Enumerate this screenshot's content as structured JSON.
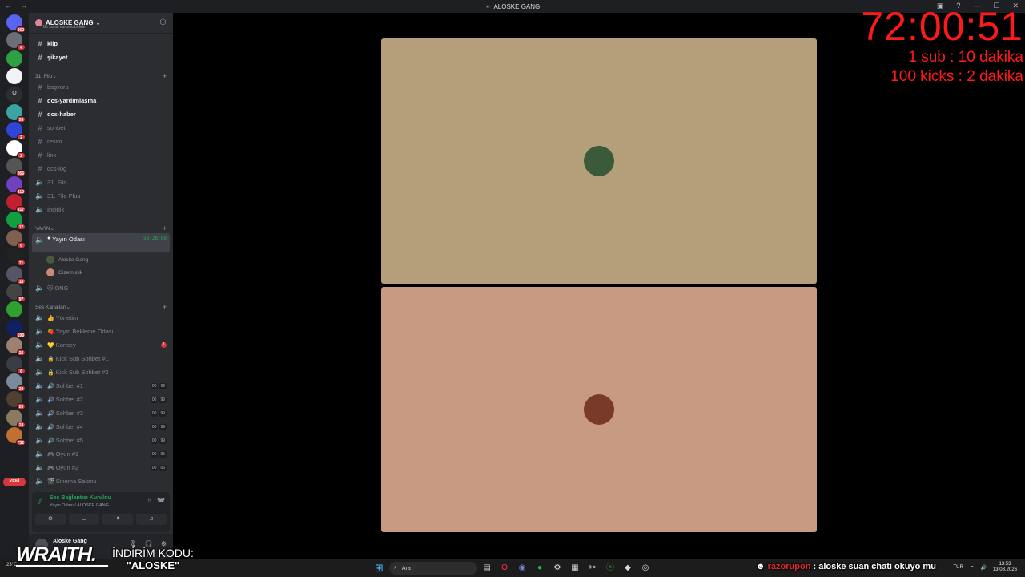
{
  "window": {
    "title": "ALOSKE GANG"
  },
  "guilds": [
    {
      "name": "discord-home",
      "badge": "262",
      "color": "#5865f2"
    },
    {
      "name": "server",
      "badge": "4",
      "color": "#6d6f78"
    },
    {
      "name": "server",
      "badge": "",
      "color": "#2ea043"
    },
    {
      "name": "server",
      "badge": "",
      "color": "#f2f3f5"
    },
    {
      "name": "server",
      "badge": "",
      "color": "#2b2d31",
      "label": "O"
    },
    {
      "name": "server",
      "badge": "24",
      "color": "#3ba4a0"
    },
    {
      "name": "server",
      "badge": "2",
      "color": "#3046d8"
    },
    {
      "name": "server",
      "badge": "2",
      "color": "#ffffff"
    },
    {
      "name": "server",
      "badge": "266",
      "color": "#555"
    },
    {
      "name": "server",
      "badge": "410",
      "color": "#7040c0"
    },
    {
      "name": "server",
      "badge": "817",
      "color": "#c02030"
    },
    {
      "name": "server",
      "badge": "17",
      "color": "#10a040"
    },
    {
      "name": "server",
      "badge": "6",
      "color": "#806050"
    },
    {
      "name": "server",
      "badge": "71",
      "color": "#222"
    },
    {
      "name": "server",
      "badge": "18",
      "color": "#556"
    },
    {
      "name": "server",
      "badge": "97",
      "color": "#444"
    },
    {
      "name": "server",
      "badge": "",
      "color": "#30a030"
    },
    {
      "name": "server",
      "badge": "193",
      "color": "#102060"
    },
    {
      "name": "server",
      "badge": "26",
      "color": "#a08070"
    },
    {
      "name": "server",
      "badge": "6",
      "color": "#3a3c43"
    },
    {
      "name": "server",
      "badge": "29",
      "color": "#7a8a9a"
    },
    {
      "name": "server",
      "badge": "20",
      "color": "#504030"
    },
    {
      "name": "server",
      "badge": "24",
      "color": "#8a7a60"
    },
    {
      "name": "server",
      "badge": "732",
      "color": "#c07030"
    }
  ],
  "guild_new_label": "YENİ",
  "server": {
    "name": "ALOSKE GANG"
  },
  "channels_top": [
    {
      "label": "klip",
      "type": "text",
      "bold": true
    },
    {
      "label": "şikayet",
      "type": "text",
      "bold": true
    }
  ],
  "cat_filo": "31. Filo",
  "channels_filo": [
    {
      "label": "başvuru",
      "type": "text",
      "bold": false
    },
    {
      "label": "dcs-yardımlaşma",
      "type": "text",
      "bold": true
    },
    {
      "label": "dcs-haber",
      "type": "text",
      "bold": true
    },
    {
      "label": "sohbet",
      "type": "text",
      "bold": false
    },
    {
      "label": "resim",
      "type": "text",
      "bold": false
    },
    {
      "label": "link",
      "type": "text",
      "bold": false
    },
    {
      "label": "dcs-log",
      "type": "text",
      "bold": false
    },
    {
      "label": "31. Filo",
      "type": "voice",
      "bold": false
    },
    {
      "label": "31. Filo Plus",
      "type": "voice",
      "bold": false
    },
    {
      "label": "İncirlik",
      "type": "voice",
      "bold": false
    }
  ],
  "cat_yayin": "YAYIN",
  "yayin_room": {
    "label": "Yayın Odası",
    "timer": "58:28:08",
    "status": "Bir kanal durumu belirle"
  },
  "yayin_users": [
    "Aloske Gang",
    "Gizemistik"
  ],
  "ong": "ONG",
  "cat_ses": "Ses Kanalları",
  "channels_ses": [
    {
      "label": "Yönetim",
      "emoji": "👍",
      "pill": []
    },
    {
      "label": "Yayın Bekleme Odası",
      "emoji": "🍓",
      "pill": []
    },
    {
      "label": "Konsey",
      "emoji": "💛",
      "badge": "1",
      "pill": []
    },
    {
      "label": "Kick Sub Sohbet #1",
      "emoji": "🔒",
      "pill": []
    },
    {
      "label": "Kick Sub Sohbet #2",
      "emoji": "🔒",
      "pill": []
    },
    {
      "label": "Sohbet #1",
      "emoji": "🔊",
      "pill": [
        "00",
        "99"
      ]
    },
    {
      "label": "Sohbet #2",
      "emoji": "🔊",
      "pill": [
        "00",
        "99"
      ]
    },
    {
      "label": "Sohbet #3",
      "emoji": "🔊",
      "pill": [
        "00",
        "99"
      ]
    },
    {
      "label": "Sohbet #4",
      "emoji": "🔊",
      "pill": [
        "00",
        "99"
      ]
    },
    {
      "label": "Sohbet #5",
      "emoji": "🔊",
      "pill": [
        "00",
        "99"
      ]
    },
    {
      "label": "Oyun #1",
      "emoji": "🎮",
      "pill": [
        "00",
        "05"
      ]
    },
    {
      "label": "Oyun #2",
      "emoji": "🎮",
      "pill": [
        "00",
        "05"
      ]
    },
    {
      "label": "Sinema Salonu",
      "emoji": "🎬",
      "pill": []
    }
  ],
  "voice_panel": {
    "title": "Ses Bağlantısı Kuruldu",
    "subtitle": "Yayın Odası / ALOSKE GANG"
  },
  "user_panel": {
    "name": "Aloske Gang",
    "status": ""
  },
  "tiles": [
    {
      "name": "Aloske Gang",
      "bg": "#b59f7b",
      "avatar": "#3a5a3a"
    },
    {
      "name": "Gizemistik",
      "bg": "#c99a82",
      "avatar": "#7a3a2a"
    }
  ],
  "overlay": {
    "timer": "72:00:51",
    "line1": "1 sub : 10 dakika",
    "line2": "100 kicks : 2 dakika"
  },
  "promo": {
    "brand": "WRAITH.",
    "line1": "İNDİRİM KODU:",
    "code": "\"ALOSKE\""
  },
  "chat": {
    "user": "razorupon",
    "message": ": aloske suan chati okuyo mu"
  },
  "taskbar": {
    "search": "Ara",
    "lang": "TUR",
    "time": "13:53",
    "date": "13.08.2026",
    "weather": "23°C"
  }
}
